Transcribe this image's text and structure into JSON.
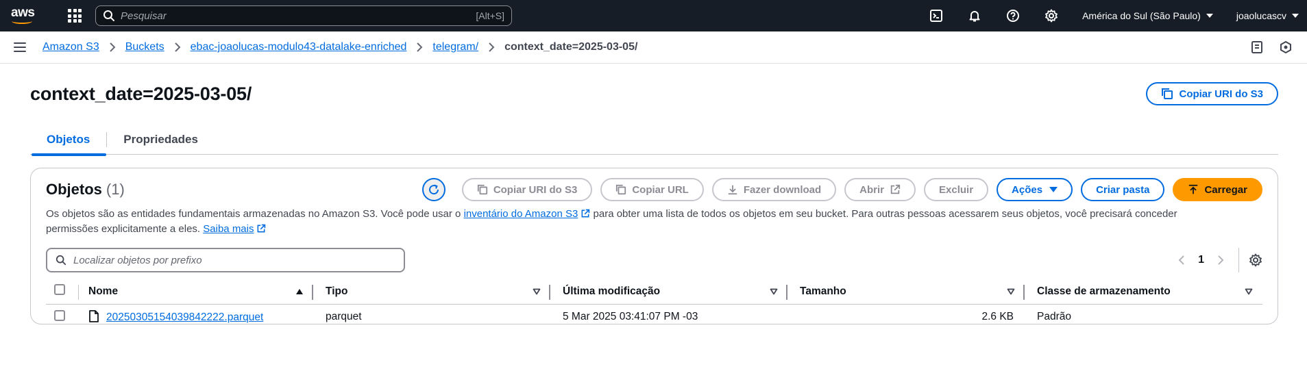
{
  "topnav": {
    "logo": "aws",
    "search_placeholder": "Pesquisar",
    "search_shortcut": "[Alt+S]",
    "region": "América do Sul (São Paulo)",
    "user": "joaolucascv"
  },
  "breadcrumb": {
    "items": [
      "Amazon S3",
      "Buckets",
      "ebac-joaolucas-modulo43-datalake-enriched",
      "telegram/"
    ],
    "current": "context_date=2025-03-05/"
  },
  "page": {
    "title": "context_date=2025-03-05/",
    "copy_uri_label": "Copiar URI do S3"
  },
  "tabs": [
    {
      "label": "Objetos",
      "active": true
    },
    {
      "label": "Propriedades",
      "active": false
    }
  ],
  "objects": {
    "title": "Objetos",
    "count": "(1)",
    "buttons": {
      "copy_uri": "Copiar URI do S3",
      "copy_url": "Copiar URL",
      "download": "Fazer download",
      "open": "Abrir",
      "delete": "Excluir",
      "actions": "Ações",
      "create_folder": "Criar pasta",
      "upload": "Carregar"
    },
    "desc_part1": "Os objetos são as entidades fundamentais armazenadas no Amazon S3. Você pode usar o",
    "desc_link1": "inventário do Amazon S3",
    "desc_part2": "para obter uma lista de todos os objetos em seu bucket. Para outras pessoas acessarem seus objetos, você precisará conceder permissões explicitamente a eles.",
    "desc_link2": "Saiba mais",
    "filter_placeholder": "Localizar objetos por prefixo",
    "page_number": "1",
    "columns": [
      "Nome",
      "Tipo",
      "Última modificação",
      "Tamanho",
      "Classe de armazenamento"
    ],
    "rows": [
      {
        "name": "20250305154039842222.parquet",
        "type": "parquet",
        "modified": "5 Mar 2025 03:41:07 PM -03",
        "size": "2.6 KB",
        "storage_class": "Padrão"
      }
    ]
  },
  "colors": {
    "nav_bg": "#161d26",
    "link": "#006ce0",
    "primary": "#ff9900",
    "border": "#c6c6cd"
  }
}
